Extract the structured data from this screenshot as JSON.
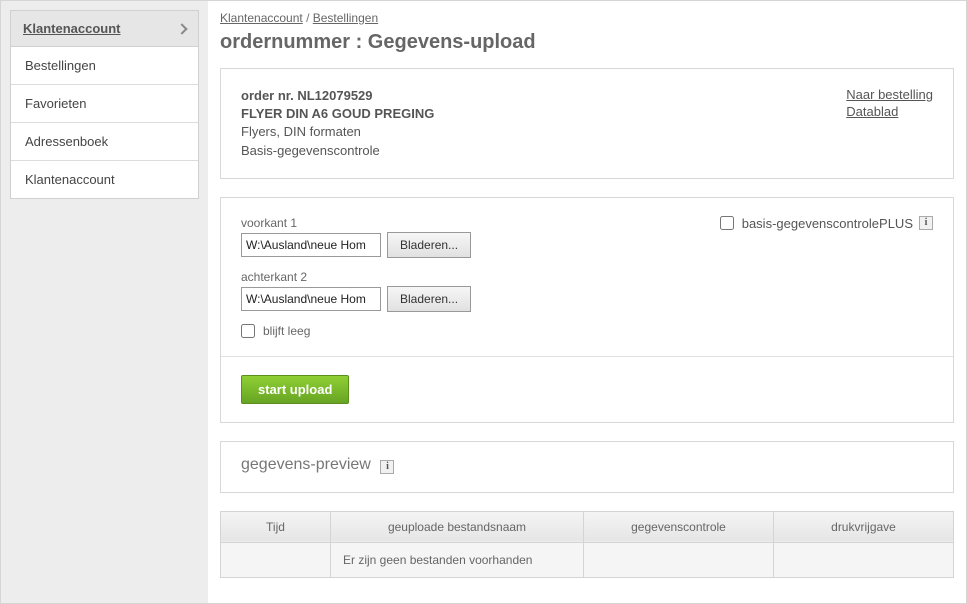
{
  "sidebar": {
    "header": "Klantenaccount",
    "items": [
      "Bestellingen",
      "Favorieten",
      "Adressenboek",
      "Klantenaccount"
    ]
  },
  "breadcrumb": {
    "a": "Klantenaccount",
    "sep": " / ",
    "b": "Bestellingen"
  },
  "title": "ordernummer : Gegevens-upload",
  "order": {
    "number_label": "order nr. NL12079529",
    "product": "FLYER DIN A6 GOUD PREGING",
    "category": "Flyers, DIN formaten",
    "check": "Basis-gegevenscontrole",
    "link_order": "Naar bestelling",
    "link_datasheet": "Datablad"
  },
  "upload": {
    "front_label": "voorkant 1",
    "back_label": "achterkant 2",
    "front_value": "W:\\Ausland\\neue Hom",
    "back_value": "W:\\Ausland\\neue Hom",
    "browse": "Bladeren...",
    "stay_empty": "blijft leeg",
    "plus_label": "basis-gegevenscontrolePLUS",
    "start": "start upload"
  },
  "preview": {
    "title": "gegevens-preview"
  },
  "table": {
    "col_time": "Tijd",
    "col_filename": "geuploade bestandsnaam",
    "col_check": "gegevenscontrole",
    "col_release": "drukvrijgave",
    "empty": "Er zijn geen bestanden voorhanden"
  }
}
